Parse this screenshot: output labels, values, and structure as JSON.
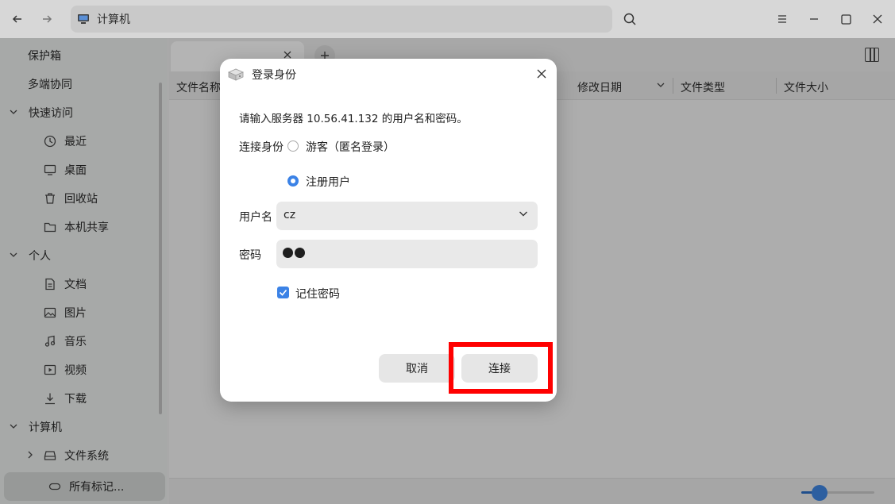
{
  "titlebar": {
    "back_icon": "arrow-left-icon",
    "forward_icon": "arrow-right-icon",
    "address": "计算机",
    "address_icon": "computer-icon",
    "search_icon": "search-icon",
    "menu_icon": "hamburger-menu-icon",
    "minimize_icon": "minimize-icon",
    "maximize_icon": "maximize-icon",
    "close_icon": "close-icon"
  },
  "sidebar": {
    "items": [
      {
        "label": "保护箱"
      },
      {
        "label": "多端协同"
      },
      {
        "label": "快速访问",
        "type": "group"
      },
      {
        "label": "最近",
        "icon": "clock-icon"
      },
      {
        "label": "桌面",
        "icon": "desktop-icon"
      },
      {
        "label": "回收站",
        "icon": "trash-icon"
      },
      {
        "label": "本机共享",
        "icon": "folder-icon"
      },
      {
        "label": "个人",
        "type": "group"
      },
      {
        "label": "文档",
        "icon": "document-icon"
      },
      {
        "label": "图片",
        "icon": "image-icon"
      },
      {
        "label": "音乐",
        "icon": "music-icon"
      },
      {
        "label": "视频",
        "icon": "video-icon"
      },
      {
        "label": "下载",
        "icon": "download-icon"
      },
      {
        "label": "计算机",
        "type": "group"
      },
      {
        "label": "文件系统",
        "icon": "drive-icon"
      },
      {
        "label": "所有标记...",
        "icon": "tag-icon",
        "selected": true
      }
    ]
  },
  "content": {
    "columns": [
      "文件名称",
      "修改日期",
      "文件类型",
      "文件大小"
    ],
    "zoom_level": 0.25
  },
  "dialog": {
    "title": "登录身份",
    "message": "请输入服务器 10.56.41.132 的用户名和密码。",
    "connect_as_label": "连接身份",
    "option_guest": "游客（匿名登录）",
    "option_registered": "注册用户",
    "selected_option": "注册用户",
    "username_label": "用户名",
    "username_value": "cz",
    "password_label": "密码",
    "password_length": 2,
    "remember_label": "记住密码",
    "remember_checked": true,
    "cancel_label": "取消",
    "connect_label": "连接"
  },
  "colors": {
    "accent": "#3b82e6",
    "highlight": "#ff0000"
  }
}
